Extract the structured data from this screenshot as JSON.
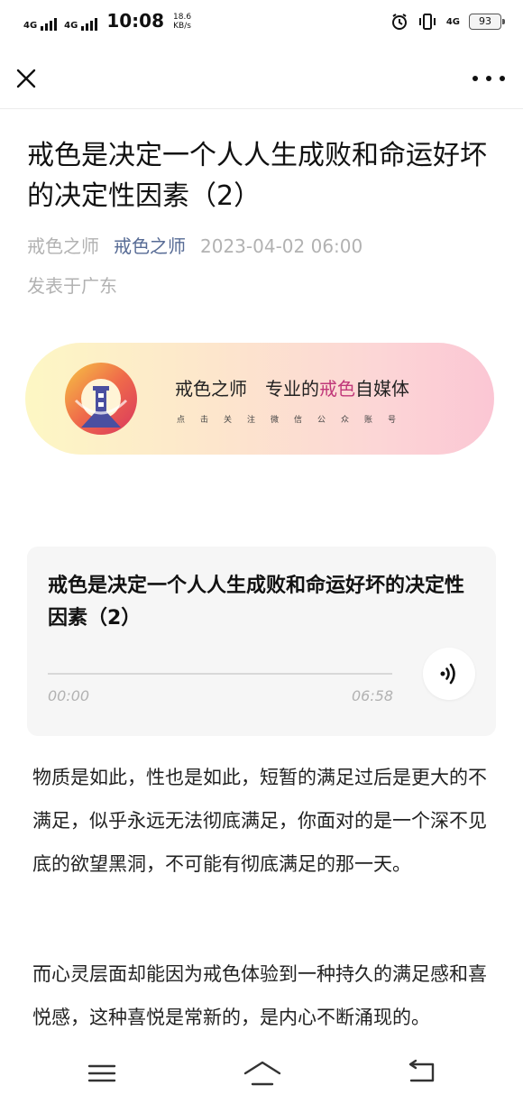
{
  "status_bar": {
    "signal1": "4G",
    "signal2": "4G",
    "time": "10:08",
    "speed_value": "18.6",
    "speed_unit": "KB/s",
    "network": "4G",
    "battery": "93",
    "icons": [
      "alarm-icon",
      "vibrate-icon",
      "network-4g-icon",
      "battery-icon"
    ]
  },
  "nav": {
    "close_icon": "close-icon",
    "more_icon": "more-icon"
  },
  "article": {
    "title": "戒色是决定一个人人生成败和命运好坏的决定性因素（2）",
    "author": "戒色之师",
    "account": "戒色之师",
    "datetime": "2023-04-02 06:00",
    "location": "发表于广东"
  },
  "banner": {
    "name": "戒色之师",
    "slogan_prefix": "专业的",
    "slogan_highlight": "戒色",
    "slogan_suffix": "自媒体",
    "subtitle": "点击关注微信公众账号",
    "colors": {
      "highlight": "#c0387a",
      "gradient_start": "#fdf7c4",
      "gradient_end": "#fbc6d4"
    }
  },
  "audio": {
    "title": "戒色是决定一个人人生成败和命运好坏的决定性因素（2）",
    "current_time": "00:00",
    "duration": "06:58",
    "progress": 0
  },
  "body": {
    "paragraphs": [
      "物质是如此，性也是如此，短暂的满足过后是更大的不满足，似乎永远无法彻底满足，你面对的是一个深不见底的欲望黑洞，不可能有彻底满足的那一天。",
      "而心灵层面却能因为戒色体验到一种持久的满足感和喜悦感，这种喜悦是常新的，是内心不断涌现的。"
    ]
  },
  "bottom_nav": {
    "items": [
      "menu-icon",
      "home-icon",
      "back-icon"
    ]
  }
}
